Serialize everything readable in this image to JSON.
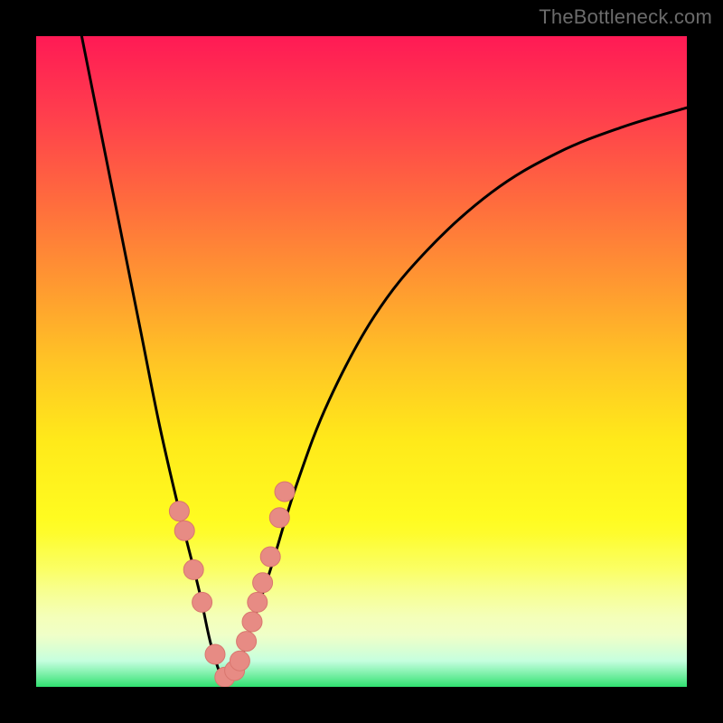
{
  "attribution": "TheBottleneck.com",
  "colors": {
    "frame": "#000000",
    "curve": "#000000",
    "marker_fill": "#e78b84",
    "marker_stroke": "#d9766e",
    "gradient_top": "#ff1a55",
    "gradient_bottom": "#30e070"
  },
  "chart_data": {
    "type": "line",
    "title": "",
    "xlabel": "",
    "ylabel": "",
    "xlim": [
      0,
      100
    ],
    "ylim": [
      0,
      100
    ],
    "grid": false,
    "legend": false,
    "note": "V-shaped bottleneck curve. Values approximate relative curve height (0 = bottom/green, 100 = top/red); minimum (optimal match) near x≈29.",
    "series": [
      {
        "name": "bottleneck-curve",
        "x": [
          7,
          10,
          13,
          16,
          19,
          22,
          25,
          27,
          29,
          31,
          33,
          36,
          40,
          45,
          52,
          60,
          70,
          80,
          90,
          100
        ],
        "y": [
          100,
          85,
          70,
          55,
          40,
          27,
          15,
          6,
          1,
          3,
          9,
          18,
          31,
          44,
          57,
          67,
          76,
          82,
          86,
          89
        ]
      }
    ],
    "markers": {
      "name": "highlighted-points",
      "note": "Salmon dots clustered around the curve minimum and lower flanks.",
      "x": [
        22.0,
        22.8,
        24.2,
        25.5,
        27.5,
        29.0,
        30.5,
        31.3,
        32.3,
        33.2,
        34.0,
        34.8,
        36.0,
        37.4,
        38.2
      ],
      "y": [
        27,
        24,
        18,
        13,
        5,
        1.5,
        2.5,
        4,
        7,
        10,
        13,
        16,
        20,
        26,
        30
      ]
    }
  }
}
